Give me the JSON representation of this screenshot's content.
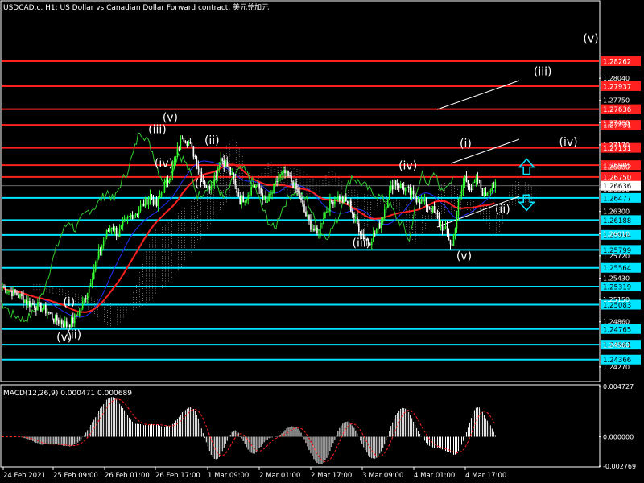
{
  "header": {
    "title": "USDCAD.c, H1:  US Dollar vs Canadian Dollar Forward contract, 美元兑加元"
  },
  "colors": {
    "background": "#000000",
    "frame": "#ffffff",
    "bull": "#33ff33",
    "bear": "#ffffff",
    "tenkan": "#ff2020",
    "kijun": "#2030ff",
    "chikou": "#33cc33",
    "cloud": "#ffffff",
    "resistance": "#ff2020",
    "support": "#00e5ff",
    "channel": "#ffffff",
    "arrows": "#00e5ff",
    "macd_hist": "#ffffff",
    "macd_signal": "#ff2020"
  },
  "chart_data": [
    {
      "type": "line",
      "title": "USDCAD.c, H1:  US Dollar vs Canadian Dollar Forward contract, 美元兑加元",
      "xlabel": "",
      "ylabel": "",
      "ylim": [
        1.2409,
        1.2904
      ],
      "x_ticks": [
        "24 Feb 2021",
        "25 Feb 09:00",
        "26 Feb 01:00",
        "26 Feb 17:00",
        "1 Mar 09:00",
        "2 Mar 01:00",
        "2 Mar 17:00",
        "3 Mar 09:00",
        "4 Mar 01:00",
        "4 Mar 17:00"
      ],
      "y_ticks": [
        1.2427,
        1.2456,
        1.2486,
        1.2515,
        1.2543,
        1.2572,
        1.2601,
        1.263,
        1.2659,
        1.2688,
        1.2717,
        1.2746,
        1.2775,
        1.2804
      ],
      "y_tick_labels": [
        "1.24270",
        "1.24560",
        "1.24860",
        "1.25150",
        "1.25430",
        "1.25720",
        "1.26010",
        "1.26300",
        "1.26590",
        "1.26880",
        "1.27170",
        "1.27460",
        "1.27750",
        "1.28040"
      ],
      "current_price": {
        "value": 1.26636,
        "label": "1.26636"
      },
      "resistance_levels": [
        {
          "value": 1.28262,
          "label": "1.28262"
        },
        {
          "value": 1.27937,
          "label": "1.27937"
        },
        {
          "value": 1.27636,
          "label": "1.27636"
        },
        {
          "value": 1.27431,
          "label": "1.27431"
        },
        {
          "value": 1.27131,
          "label": "1.27131"
        },
        {
          "value": 1.26905,
          "label": "1.26905"
        },
        {
          "value": 1.2675,
          "label": "1.26750"
        }
      ],
      "support_levels": [
        {
          "value": 1.26477,
          "label": "1.26477"
        },
        {
          "value": 1.26188,
          "label": "1.26188"
        },
        {
          "value": 1.25994,
          "label": "1.25994"
        },
        {
          "value": 1.25799,
          "label": "1.25799"
        },
        {
          "value": 1.25564,
          "label": "1.25564"
        },
        {
          "value": 1.25319,
          "label": "1.25319"
        },
        {
          "value": 1.25083,
          "label": "1.25083"
        },
        {
          "value": 1.24765,
          "label": "1.24765"
        },
        {
          "value": 1.24561,
          "label": "1.24561"
        },
        {
          "value": 1.24366,
          "label": "1.24366"
        }
      ],
      "price_path": [
        [
          0,
          1.2531
        ],
        [
          4,
          1.2527
        ],
        [
          8,
          1.2523
        ],
        [
          12,
          1.2518
        ],
        [
          16,
          1.2511
        ],
        [
          20,
          1.2508
        ],
        [
          24,
          1.2505
        ],
        [
          28,
          1.25
        ],
        [
          32,
          1.249
        ],
        [
          36,
          1.2487
        ],
        [
          40,
          1.2482
        ],
        [
          44,
          1.2488
        ],
        [
          48,
          1.25
        ],
        [
          52,
          1.252
        ],
        [
          56,
          1.2548
        ],
        [
          60,
          1.2575
        ],
        [
          64,
          1.2598
        ],
        [
          68,
          1.2612
        ],
        [
          72,
          1.26
        ],
        [
          76,
          1.2615
        ],
        [
          80,
          1.2625
        ],
        [
          84,
          1.263
        ],
        [
          88,
          1.264
        ],
        [
          92,
          1.265
        ],
        [
          96,
          1.2638
        ],
        [
          100,
          1.266
        ],
        [
          104,
          1.2675
        ],
        [
          108,
          1.27
        ],
        [
          112,
          1.273
        ],
        [
          116,
          1.272
        ],
        [
          120,
          1.2702
        ],
        [
          124,
          1.2675
        ],
        [
          128,
          1.266
        ],
        [
          132,
          1.2675
        ],
        [
          136,
          1.27
        ],
        [
          140,
          1.269
        ],
        [
          144,
          1.267
        ],
        [
          148,
          1.2645
        ],
        [
          152,
          1.265
        ],
        [
          156,
          1.2665
        ],
        [
          160,
          1.266
        ],
        [
          164,
          1.264
        ],
        [
          168,
          1.2655
        ],
        [
          172,
          1.2675
        ],
        [
          176,
          1.268
        ],
        [
          180,
          1.267
        ],
        [
          184,
          1.2655
        ],
        [
          188,
          1.263
        ],
        [
          192,
          1.2612
        ],
        [
          196,
          1.26
        ],
        [
          200,
          1.2625
        ],
        [
          204,
          1.264
        ],
        [
          208,
          1.265
        ],
        [
          212,
          1.2645
        ],
        [
          216,
          1.264
        ],
        [
          220,
          1.2618
        ],
        [
          224,
          1.26
        ],
        [
          228,
          1.259
        ],
        [
          232,
          1.2602
        ],
        [
          236,
          1.2618
        ],
        [
          240,
          1.265
        ],
        [
          244,
          1.267
        ],
        [
          248,
          1.2663
        ],
        [
          252,
          1.2658
        ],
        [
          256,
          1.265
        ],
        [
          260,
          1.2645
        ],
        [
          264,
          1.264
        ],
        [
          268,
          1.2632
        ],
        [
          272,
          1.2615
        ],
        [
          276,
          1.2605
        ],
        [
          280,
          1.2585
        ],
        [
          284,
          1.264
        ],
        [
          288,
          1.2675
        ],
        [
          292,
          1.266
        ],
        [
          296,
          1.2672
        ],
        [
          300,
          1.265
        ],
        [
          304,
          1.2663
        ]
      ],
      "wave_labels": [
        {
          "text": "(v)",
          "x": 39,
          "y": 1.2461
        },
        {
          "text": "(i)",
          "x": 42,
          "y": 1.2507
        },
        {
          "text": "(ii)",
          "x": 45,
          "y": 1.2464
        },
        {
          "text": "(iii)",
          "x": 97,
          "y": 1.2732
        },
        {
          "text": "(v)",
          "x": 105,
          "y": 1.2748
        },
        {
          "text": "(iv)",
          "x": 101,
          "y": 1.2688
        },
        {
          "text": "(ii)",
          "x": 131,
          "y": 1.2718
        },
        {
          "text": "(i)",
          "x": 124,
          "y": 1.2662
        },
        {
          "text": "(iv)",
          "x": 253,
          "y": 1.2685
        },
        {
          "text": "(iii)",
          "x": 224,
          "y": 1.2584
        },
        {
          "text": "(i)",
          "x": 289,
          "y": 1.2714
        },
        {
          "text": "(v)",
          "x": 288,
          "y": 1.2567
        },
        {
          "text": "(ii)",
          "x": 312,
          "y": 1.2628
        },
        {
          "text": "(v)",
          "x": 367,
          "y": 1.2851
        },
        {
          "text": "(iii)",
          "x": 337,
          "y": 1.2808
        },
        {
          "text": "(iv)",
          "x": 353,
          "y": 1.2716
        }
      ],
      "arrows": [
        {
          "direction": "up",
          "x": 327,
          "y": 1.2688
        },
        {
          "direction": "down",
          "x": 327,
          "y": 1.2642
        }
      ]
    },
    {
      "type": "bar",
      "title": "MACD(12,26,9) 0.000471 0.000689",
      "ylim": [
        -0.00276,
        0.00473
      ],
      "y_ticks": [
        0.004727,
        0.0,
        -0.002769
      ],
      "y_tick_labels": [
        "0.004727",
        "0.000000",
        "-0.002769"
      ],
      "main": 0.000471,
      "signal": 0.000689
    }
  ]
}
